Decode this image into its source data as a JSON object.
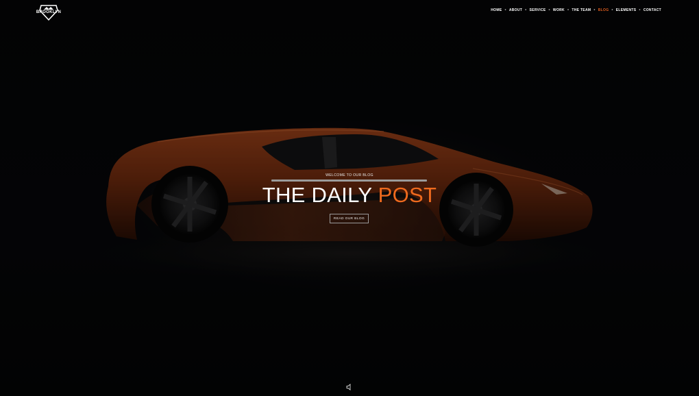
{
  "header": {
    "logo_text": "BROOKLYN",
    "nav": [
      {
        "label": "HOME",
        "active": false
      },
      {
        "label": "ABOUT",
        "active": false
      },
      {
        "label": "SERVICE",
        "active": false
      },
      {
        "label": "WORK",
        "active": false
      },
      {
        "label": "THE TEAM",
        "active": false
      },
      {
        "label": "BLOG",
        "active": true
      },
      {
        "label": "ELEMENTS",
        "active": false
      },
      {
        "label": "CONTACT",
        "active": false
      }
    ],
    "active_color": "#e05e1f"
  },
  "hero": {
    "subtitle": "WELCOME TO OUR BLOG",
    "title_main": "THE DAILY ",
    "title_accent": "POST",
    "accent_color": "#ef6a1e",
    "button_label": "READ OUR BLOG",
    "background_image": "orange sports car on dark background",
    "mute_icon": "speaker-mute-icon"
  }
}
